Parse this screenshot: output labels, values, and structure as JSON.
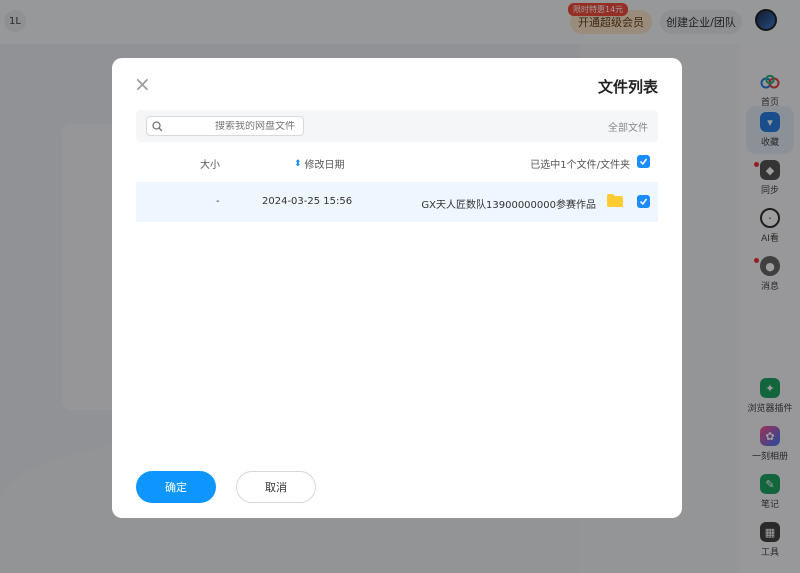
{
  "header": {
    "corner_label": "1L",
    "vip_button": "开通超级会员",
    "vip_badge": "限时特惠14元",
    "team_button": "创建企业/团队"
  },
  "sidebar": {
    "items": [
      {
        "label": "首页",
        "icon": "cloud-icon"
      },
      {
        "label": "收藏",
        "icon": "bookmark-icon"
      },
      {
        "label": "同步",
        "icon": "sync-icon"
      },
      {
        "label": "AI看",
        "icon": "ai-icon"
      },
      {
        "label": "消息",
        "icon": "message-icon"
      },
      {
        "label": "浏览器插件",
        "icon": "browser-plugin-icon"
      },
      {
        "label": "一刻相册",
        "icon": "album-icon"
      },
      {
        "label": "笔记",
        "icon": "note-icon"
      },
      {
        "label": "工具",
        "icon": "tools-icon"
      }
    ]
  },
  "dialog": {
    "title": "文件列表",
    "path": "全部文件",
    "search_placeholder": "搜索我的网盘文件",
    "columns": {
      "name": "已选中1个文件/文件夹",
      "date": "修改日期",
      "size": "大小"
    },
    "rows": [
      {
        "name": "GX天人匠数队13900000000参赛作品",
        "date": "2024-03-25 15:56",
        "size": "-"
      }
    ],
    "ok_button": "确定",
    "cancel_button": "取消"
  },
  "colors": {
    "accent": "#0d96ff",
    "row_selected": "#eef6ff",
    "folder": "#ffcc33"
  }
}
